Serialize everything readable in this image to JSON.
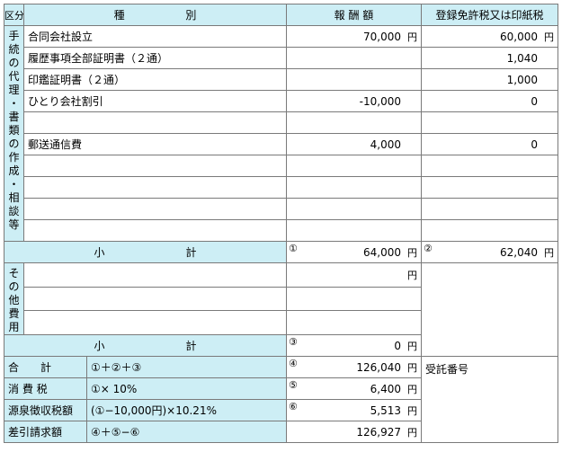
{
  "header": {
    "kubun": "区分",
    "shubetsu_1": "種",
    "shubetsu_2": "別",
    "houshu": "報 酬 額",
    "tax": "登録免許税又は印紙税"
  },
  "section_main": {
    "label": [
      "手",
      "続",
      "の",
      "代",
      "理",
      "・",
      "書",
      "類",
      "の",
      "作",
      "成",
      "・",
      "相",
      "談",
      "等"
    ],
    "rows": [
      {
        "name": "合同会社設立",
        "fee": "70,000",
        "fee_unit": "円",
        "tax": "60,000",
        "tax_unit": "円"
      },
      {
        "name": "履歴事項全部証明書（２通）",
        "fee": "",
        "fee_unit": "",
        "tax": "1,040",
        "tax_unit": ""
      },
      {
        "name": "印鑑証明書（２通）",
        "fee": "",
        "fee_unit": "",
        "tax": "1,000",
        "tax_unit": ""
      },
      {
        "name": "ひとり会社割引",
        "fee": "-10,000",
        "fee_unit": "",
        "tax": "0",
        "tax_unit": ""
      },
      {
        "name": "",
        "fee": "",
        "fee_unit": "",
        "tax": "",
        "tax_unit": ""
      },
      {
        "name": "郵送通信費",
        "fee": "4,000",
        "fee_unit": "",
        "tax": "0",
        "tax_unit": ""
      },
      {
        "name": "",
        "fee": "",
        "fee_unit": "",
        "tax": "",
        "tax_unit": ""
      },
      {
        "name": "",
        "fee": "",
        "fee_unit": "",
        "tax": "",
        "tax_unit": ""
      },
      {
        "name": "",
        "fee": "",
        "fee_unit": "",
        "tax": "",
        "tax_unit": ""
      },
      {
        "name": "",
        "fee": "",
        "fee_unit": "",
        "tax": "",
        "tax_unit": ""
      }
    ],
    "subtotal_label_1": "小",
    "subtotal_label_2": "計",
    "subtotal_fee_mark": "①",
    "subtotal_fee": "64,000",
    "subtotal_fee_unit": "円",
    "subtotal_tax_mark": "②",
    "subtotal_tax": "62,040",
    "subtotal_tax_unit": "円"
  },
  "section_other": {
    "label": [
      "そ",
      "の",
      "他",
      "費",
      "用"
    ],
    "rows": [
      {
        "name": "",
        "fee": "",
        "fee_unit": "円"
      },
      {
        "name": "",
        "fee": "",
        "fee_unit": ""
      },
      {
        "name": "",
        "fee": "",
        "fee_unit": ""
      }
    ],
    "subtotal_label_1": "小",
    "subtotal_label_2": "計",
    "subtotal_mark": "③",
    "subtotal_value": "0",
    "subtotal_unit": "円"
  },
  "totals": [
    {
      "label": "合　　計",
      "formula": "①＋②＋③",
      "mark": "④",
      "value": "126,040",
      "unit": "円"
    },
    {
      "label": "消 費 税",
      "formula": "①× 10%",
      "mark": "⑤",
      "value": "6,400",
      "unit": "円"
    },
    {
      "label": "源泉徴収税額",
      "formula": "(①−10,000円)×10.21%",
      "mark": "⑥",
      "value": "5,513",
      "unit": "円"
    },
    {
      "label": "差引請求額",
      "formula": "④＋⑤−⑥",
      "mark": "",
      "value": "126,927",
      "unit": "円"
    }
  ],
  "receipt_label": "受託番号"
}
